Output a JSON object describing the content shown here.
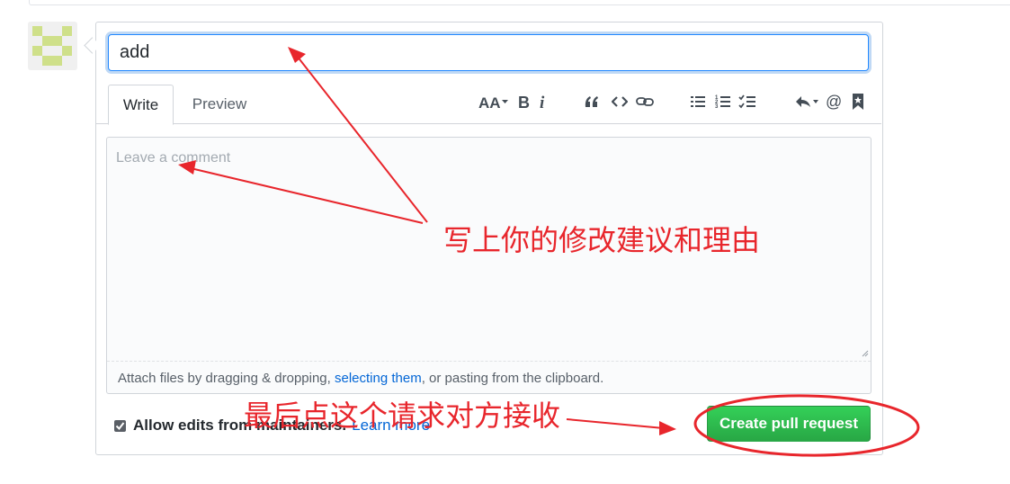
{
  "pr_form": {
    "title_value": "add",
    "tabs": [
      {
        "label": "Write",
        "active": true
      },
      {
        "label": "Preview",
        "active": false
      }
    ],
    "toolbar_icons": [
      "header-text-icon",
      "bold-icon",
      "italic-icon",
      "quote-icon",
      "code-icon",
      "link-icon",
      "unordered-list-icon",
      "ordered-list-icon",
      "task-list-icon",
      "reply-icon",
      "mention-icon",
      "bookmark-icon"
    ],
    "comment_placeholder": "Leave a comment",
    "attach": {
      "prefix": "Attach files by dragging & dropping, ",
      "link": "selecting them",
      "suffix": ", or pasting from the clipboard."
    },
    "allow_edits_label": "Allow edits from maintainers.",
    "allow_edits_checked": true,
    "learn_more": "Learn more",
    "create_button": "Create pull request"
  },
  "annotations": {
    "note_1": "写上你的修改建议和理由",
    "note_2": "最后点这个请求对方接收",
    "color": "#e8262c"
  },
  "colors": {
    "accent_blue": "#0366d6",
    "button_green": "#28a745"
  }
}
